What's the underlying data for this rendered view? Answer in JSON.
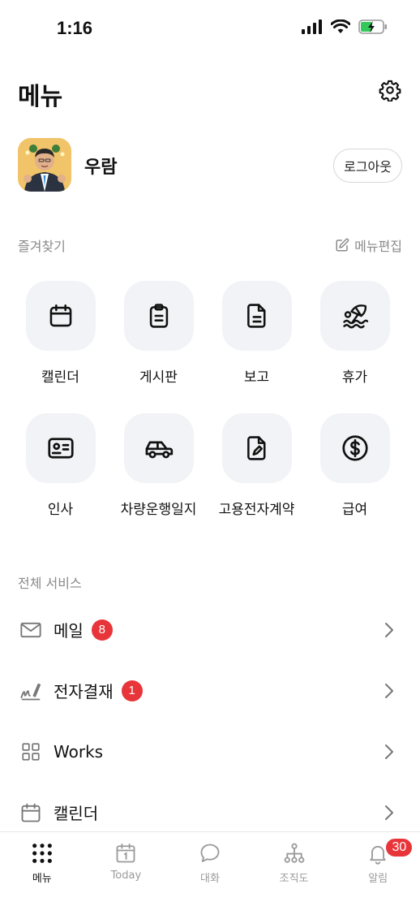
{
  "status_bar": {
    "time": "1:16"
  },
  "header": {
    "title": "메뉴"
  },
  "profile": {
    "name": "우람",
    "logout_label": "로그아웃"
  },
  "favorites": {
    "section_label": "즐겨찾기",
    "edit_label": "메뉴편집",
    "items": [
      {
        "label": "캘린더",
        "icon": "calendar-icon"
      },
      {
        "label": "게시판",
        "icon": "clipboard-icon"
      },
      {
        "label": "보고",
        "icon": "document-icon"
      },
      {
        "label": "휴가",
        "icon": "beach-umbrella-icon"
      },
      {
        "label": "인사",
        "icon": "id-card-icon"
      },
      {
        "label": "차량운행일지",
        "icon": "car-icon"
      },
      {
        "label": "고용전자계약",
        "icon": "contract-edit-icon"
      },
      {
        "label": "급여",
        "icon": "dollar-icon"
      }
    ]
  },
  "services": {
    "section_label": "전체 서비스",
    "items": [
      {
        "label": "메일",
        "icon": "mail-icon",
        "badge": "8"
      },
      {
        "label": "전자결재",
        "icon": "signature-icon",
        "badge": "1"
      },
      {
        "label": "Works",
        "icon": "grid-icon",
        "badge": null
      },
      {
        "label": "캘린더",
        "icon": "calendar-icon",
        "badge": null
      }
    ]
  },
  "tab_bar": {
    "tabs": [
      {
        "label": "메뉴",
        "icon": "dots-grid-icon",
        "active": true
      },
      {
        "label": "Today",
        "icon": "calendar-today-icon",
        "active": false
      },
      {
        "label": "대화",
        "icon": "chat-bubble-icon",
        "active": false
      },
      {
        "label": "조직도",
        "icon": "org-chart-icon",
        "active": false
      },
      {
        "label": "알림",
        "icon": "bell-icon",
        "active": false,
        "badge": "30"
      }
    ]
  },
  "colors": {
    "badge_red": "#e8353a",
    "tile_bg": "#f2f3f6",
    "muted_text": "#8a8a8a"
  }
}
